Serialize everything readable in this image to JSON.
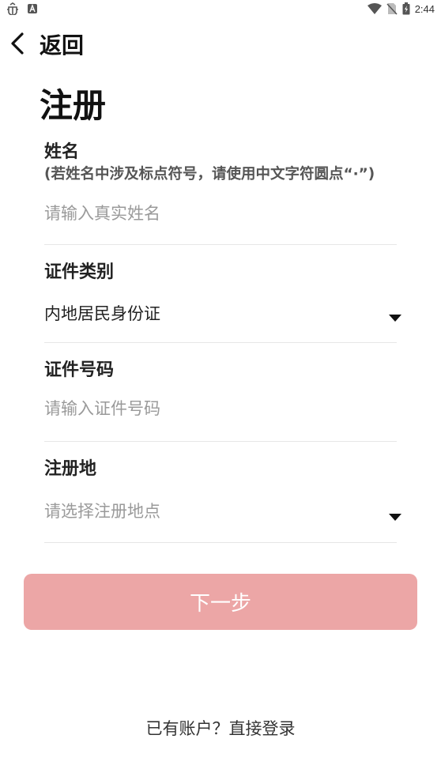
{
  "status_bar": {
    "time": "2:44",
    "left_icons": [
      "bug-icon",
      "app-a-icon"
    ],
    "right_icons": [
      "wifi-icon",
      "no-sim-icon",
      "battery-charging-icon"
    ]
  },
  "header": {
    "back_label": "返回",
    "back_icon": "chevron-left-icon"
  },
  "page_title": "注册",
  "form": {
    "name": {
      "label": "姓名",
      "hint": "(若姓名中涉及标点符号，请使用中文字符圆点“·”)",
      "placeholder": "请输入真实姓名",
      "value": ""
    },
    "id_type": {
      "label": "证件类别",
      "value": "内地居民身份证",
      "icon": "caret-down-icon"
    },
    "id_number": {
      "label": "证件号码",
      "placeholder": "请输入证件号码",
      "value": ""
    },
    "region": {
      "label": "注册地",
      "placeholder": "请选择注册地点",
      "icon": "caret-down-icon"
    }
  },
  "next_button": {
    "label": "下一步",
    "color": "#eca6a6"
  },
  "footer": {
    "prompt": "已有账户？",
    "login_link": "直接登录"
  }
}
